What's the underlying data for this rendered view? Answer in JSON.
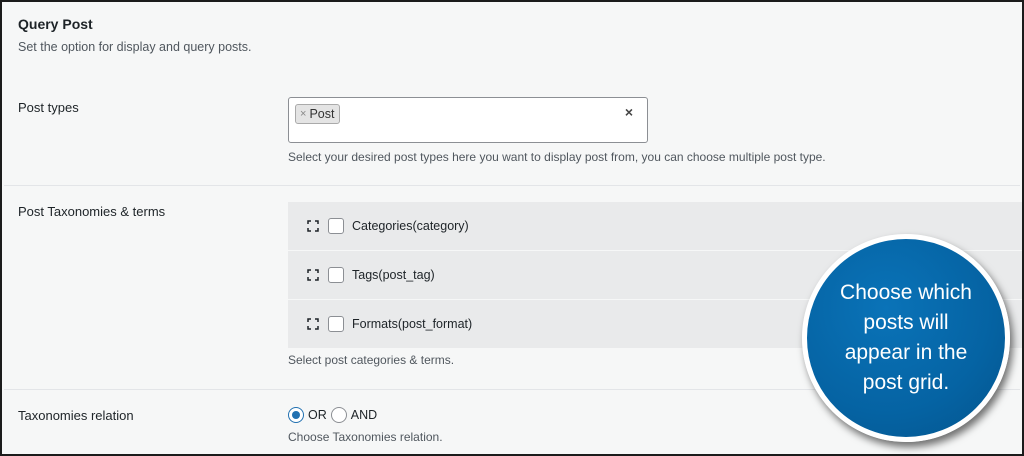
{
  "section": {
    "title": "Query Post",
    "description": "Set the option for display and query posts."
  },
  "post_types": {
    "label": "Post types",
    "selected": [
      "Post"
    ],
    "tag_remove_glyph": "×",
    "clear_glyph": "×",
    "help": "Select your desired post types here you want to display post from, you can choose multiple post type."
  },
  "taxonomies": {
    "label": "Post Taxonomies & terms",
    "items": [
      {
        "label": "Categories(category)",
        "checked": false
      },
      {
        "label": "Tags(post_tag)",
        "checked": false
      },
      {
        "label": "Formats(post_format)",
        "checked": false
      }
    ],
    "help": "Select post categories & terms."
  },
  "relation": {
    "label": "Taxonomies relation",
    "options": [
      {
        "label": "OR",
        "checked": true
      },
      {
        "label": "AND",
        "checked": false
      }
    ],
    "help": "Choose Taxonomies relation."
  },
  "callout": {
    "text": "Choose which\nposts will\nappear in the\npost grid."
  },
  "colors": {
    "accent": "#2271b1",
    "callout_bg": "#0563a3",
    "panel_bg": "#f6f7f7",
    "item_bg": "#e9eaeb"
  },
  "icons": {
    "drag": "drag-handle-icon"
  }
}
